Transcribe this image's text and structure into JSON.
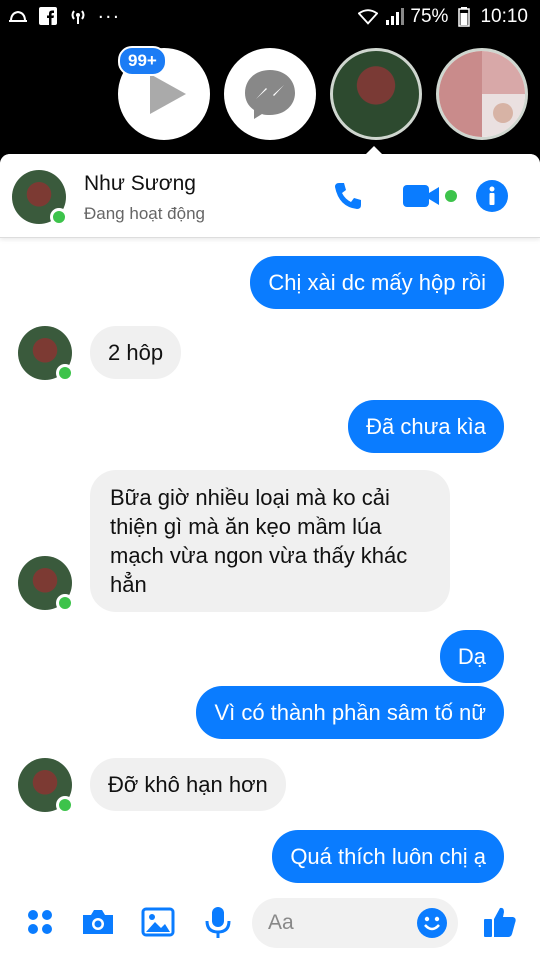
{
  "status_bar": {
    "battery": "75%",
    "time": "10:10",
    "more": "..."
  },
  "chat_heads": {
    "badge": "99+"
  },
  "header": {
    "name": "Như Sương",
    "status": "Đang hoạt động"
  },
  "messages": [
    {
      "from": "me",
      "text": "Chị xài dc mấy hộp rồi"
    },
    {
      "from": "them",
      "text": "2 hôp"
    },
    {
      "from": "me",
      "text": "Đã chưa kìa"
    },
    {
      "from": "them",
      "text": "Bữa giờ nhiều loại mà ko cải thiện gì mà ăn kẹo mầm lúa mạch vừa ngon vừa thấy khác hẳn"
    },
    {
      "from": "me",
      "text": "Dạ"
    },
    {
      "from": "me",
      "text": "Vì có thành phần sâm tố nữ"
    },
    {
      "from": "them",
      "text": "Đỡ khô hạn hơn"
    },
    {
      "from": "me",
      "text": "Quá thích luôn chị ạ"
    }
  ],
  "composer": {
    "placeholder": "Aa"
  },
  "colors": {
    "accent": "#0a7cff",
    "online": "#3dc34b",
    "incoming_bubble": "#f0f0f0"
  },
  "icons": [
    "notification-icon",
    "facebook-icon",
    "hotspot-icon",
    "wifi-icon",
    "signal-icon",
    "phone-icon",
    "video-icon",
    "info-icon",
    "apps-icon",
    "camera-icon",
    "gallery-icon",
    "mic-icon",
    "emoji-icon",
    "like-icon"
  ]
}
